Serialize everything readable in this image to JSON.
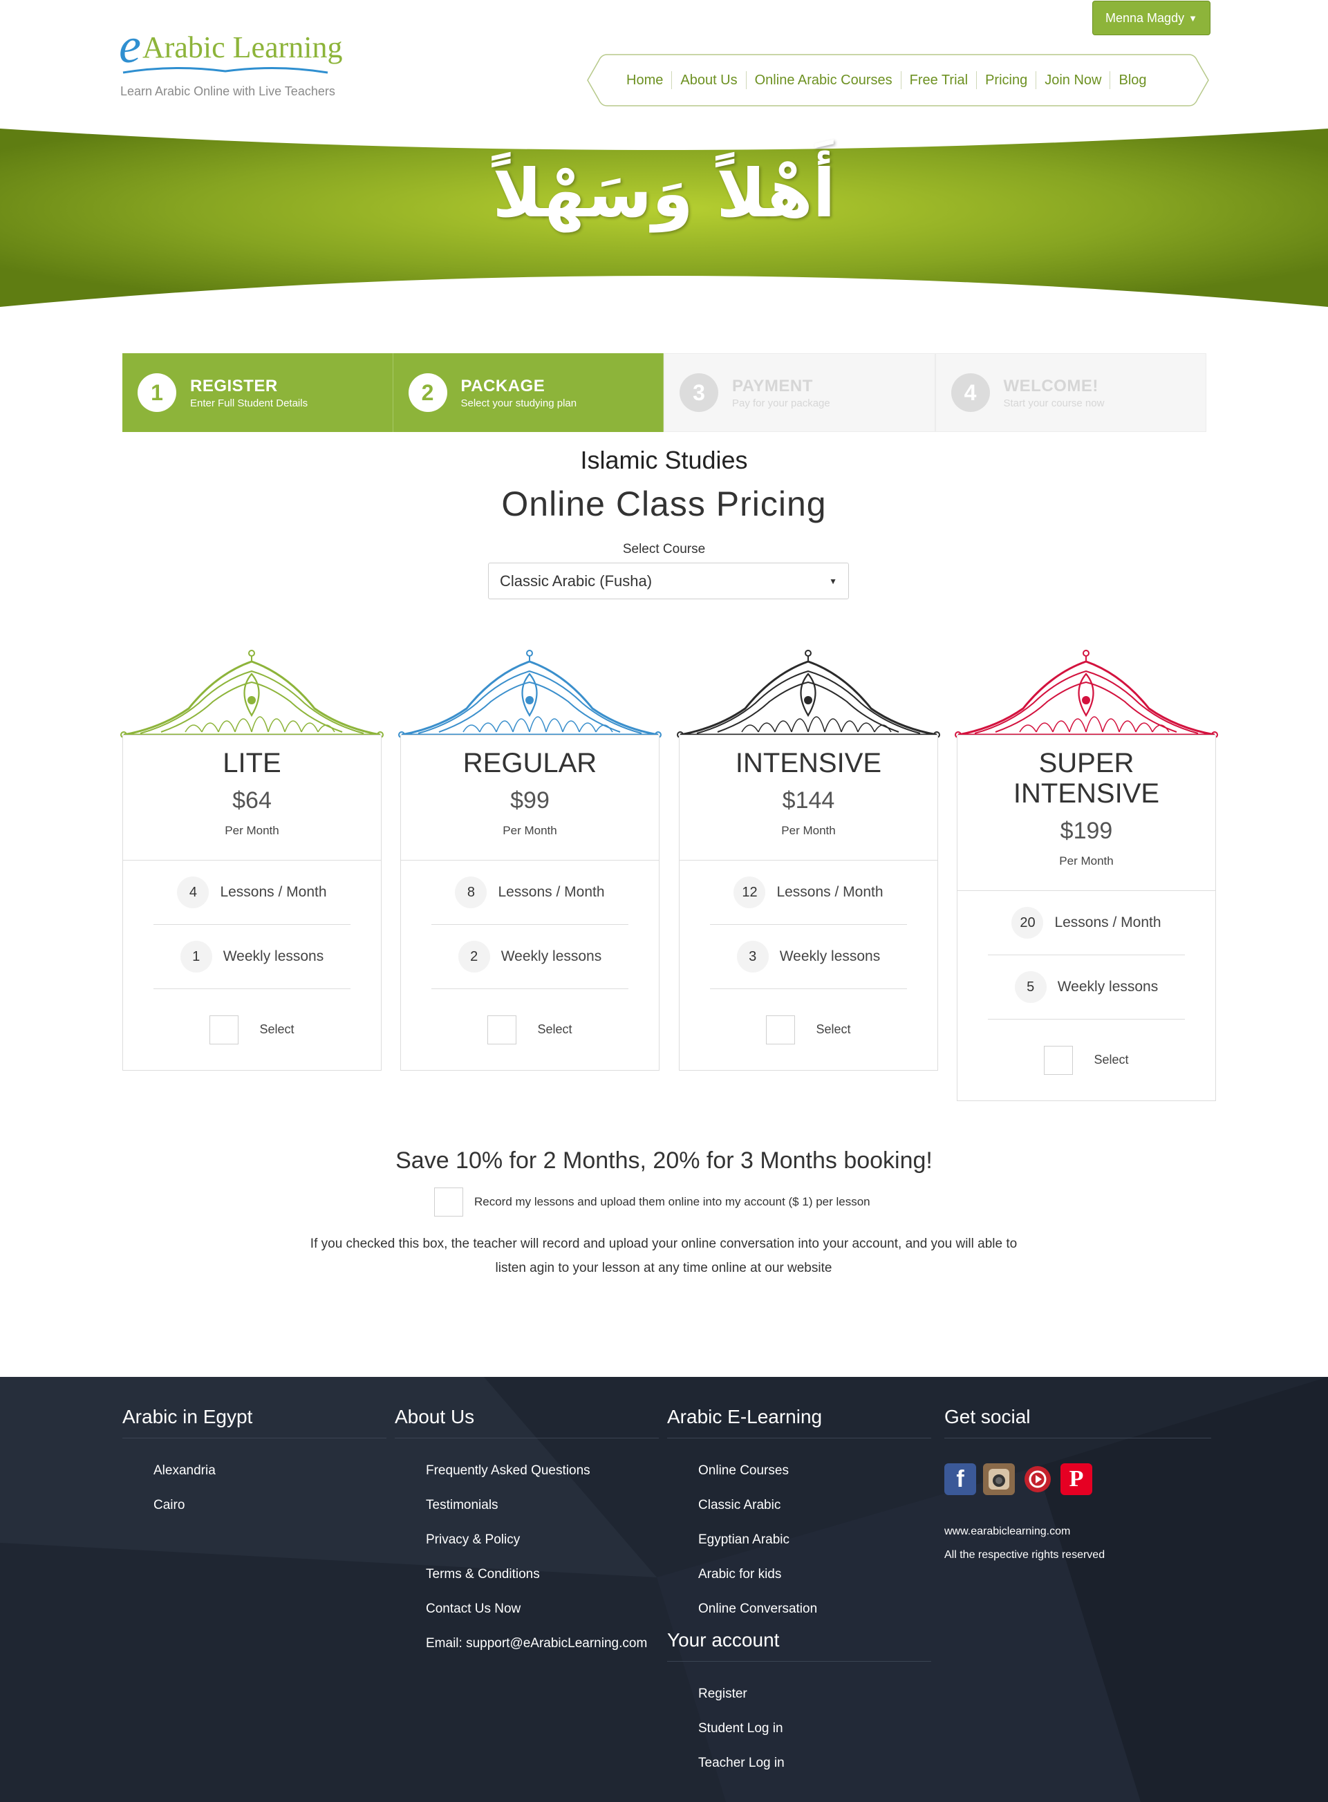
{
  "header": {
    "logo_e": "e",
    "logo_text": "Arabic Learning",
    "tagline": "Learn Arabic Online with Live Teachers",
    "user_name": "Menna Magdy",
    "nav": [
      "Home",
      "About Us",
      "Online Arabic Courses",
      "Free Trial",
      "Pricing",
      "Join Now",
      "Blog"
    ]
  },
  "banner": {
    "arabic_text": "أَهْلاً وَسَهْلاً",
    "colors": {
      "light": "#b6cf31",
      "dark": "#5f7d12"
    }
  },
  "steps": [
    {
      "num": "1",
      "title": "REGISTER",
      "sub": "Enter Full Student Details",
      "state": "active"
    },
    {
      "num": "2",
      "title": "PACKAGE",
      "sub": "Select your studying plan",
      "state": "active"
    },
    {
      "num": "3",
      "title": "PAYMENT",
      "sub": "Pay for your package",
      "state": "inactive"
    },
    {
      "num": "4",
      "title": "WELCOME!",
      "sub": "Start your course now",
      "state": "inactive"
    }
  ],
  "main": {
    "course_title": "Islamic Studies",
    "pricing_title": "Online Class Pricing",
    "select_label": "Select Course",
    "selected_course": "Classic Arabic (Fusha)"
  },
  "plans": [
    {
      "name": "LITE",
      "price": "$64",
      "per": "Per Month",
      "lessons": "4",
      "lessons_label": "Lessons / Month",
      "weekly": "1",
      "weekly_label": "Weekly lessons",
      "select_label": "Select",
      "color": "#8db43a"
    },
    {
      "name": "REGULAR",
      "price": "$99",
      "per": "Per Month",
      "lessons": "8",
      "lessons_label": "Lessons / Month",
      "weekly": "2",
      "weekly_label": "Weekly lessons",
      "select_label": "Select",
      "color": "#3a8fcc"
    },
    {
      "name": "INTENSIVE",
      "price": "$144",
      "per": "Per Month",
      "lessons": "12",
      "lessons_label": "Lessons / Month",
      "weekly": "3",
      "weekly_label": "Weekly lessons",
      "select_label": "Select",
      "color": "#2a2a2a"
    },
    {
      "name": "SUPER INTENSIVE",
      "price": "$199",
      "per": "Per Month",
      "lessons": "20",
      "lessons_label": "Lessons / Month",
      "weekly": "5",
      "weekly_label": "Weekly lessons",
      "select_label": "Select",
      "color": "#d3123e"
    }
  ],
  "save": {
    "headline": "Save 10% for 2 Months, 20% for 3 Months booking!",
    "record_label": "Record my lessons and upload them online into my account ($ 1) per lesson",
    "note": "If you checked this box, the teacher will record and upload your online conversation into your account, and you will able to listen agin to your lesson at any time online at our website"
  },
  "footer": {
    "egypt": {
      "title": "Arabic in Egypt",
      "items": [
        "Alexandria",
        "Cairo"
      ]
    },
    "about": {
      "title": "About Us",
      "items": [
        "Frequently Asked Questions",
        "Testimonials",
        "Privacy & Policy",
        "Terms & Conditions",
        "Contact Us Now",
        "Email: support@eArabicLearning.com"
      ]
    },
    "elearning": {
      "title": "Arabic E-Learning",
      "items": [
        "Online Courses",
        "Classic Arabic",
        "Egyptian Arabic",
        "Arabic for kids",
        "Online Conversation"
      ]
    },
    "account": {
      "title": "Your account",
      "items": [
        "Register",
        "Student Log in",
        "Teacher Log in"
      ]
    },
    "social": {
      "title": "Get social",
      "site": "www.earabiclearning.com",
      "rights": "All the respective rights reserved"
    }
  }
}
